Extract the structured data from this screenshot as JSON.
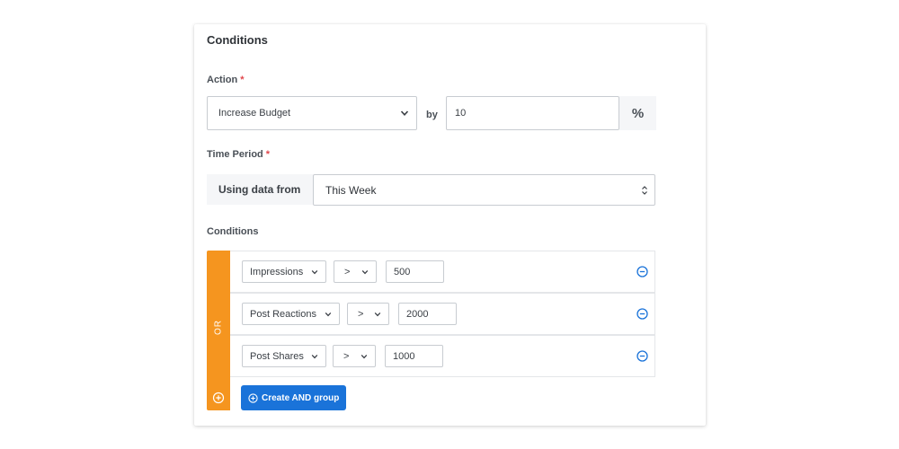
{
  "card": {
    "title": "Conditions"
  },
  "action": {
    "label": "Action",
    "required_mark": "*",
    "selected": "Increase Budget",
    "by_text": "by",
    "amount_value": "10",
    "unit": "%"
  },
  "time_period": {
    "label": "Time Period",
    "required_mark": "*",
    "prefix": "Using data from",
    "selected": "This Week"
  },
  "conditions": {
    "label": "Conditions",
    "group_operator": "OR",
    "rows": [
      {
        "metric": "Impressions",
        "operator": ">",
        "value": "500"
      },
      {
        "metric": "Post Reactions",
        "operator": ">",
        "value": "2000"
      },
      {
        "metric": "Post Shares",
        "operator": ">",
        "value": "1000"
      }
    ],
    "create_and_group_label": "Create AND group"
  },
  "colors": {
    "or_bar": "#f5951f",
    "primary_button": "#1a73d9",
    "remove_icon": "#1a73d9",
    "required": "#e0474c"
  },
  "icons": {
    "select_chevron": "chevron-down-icon",
    "period_select": "updown-arrows-icon",
    "remove_condition": "minus-circle-icon",
    "add_or": "plus-circle-icon",
    "create_and": "plus-circle-icon"
  }
}
